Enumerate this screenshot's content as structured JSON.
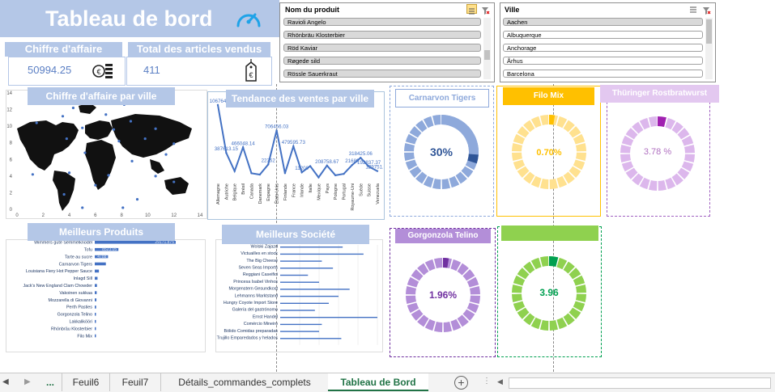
{
  "title": "Tableau de bord",
  "kpi": {
    "revenue_label": "Chiffre d'affaire",
    "revenue_value": "50994.25",
    "items_label": "Total des articles vendus",
    "items_value": "411"
  },
  "slicers": {
    "product": {
      "title": "Nom du produit",
      "items": [
        "Ravioli Angelo",
        "Rhönbräu Klosterbier",
        "Röd Kaviar",
        "Røgede sild",
        "Rössle Sauerkraut"
      ]
    },
    "city": {
      "title": "Ville",
      "items": [
        "Aachen",
        "Albuquerque",
        "Anchorage",
        "Århus",
        "Barcelona"
      ]
    }
  },
  "sections": {
    "map_title": "Chiffre d'affaire par ville",
    "trend_title": "Tendance des ventes par ville",
    "products_title": "Meilleurs Produits",
    "companies_title": "Meilleurs Société"
  },
  "donuts": [
    {
      "title": "Carnarvon Tigers",
      "value_text": "30%",
      "percent": 30,
      "color": "#8ea9db",
      "accent": "#2f5597",
      "title_bg": "#ffffff",
      "title_color": "#8ea9db",
      "text_color": "#2f5597"
    },
    {
      "title": "Filo Mix",
      "value_text": "0.70%",
      "percent": 0.7,
      "color": "#ffe18f",
      "accent": "#ffc000",
      "title_bg": "#ffc000",
      "title_color": "#ffffff",
      "text_color": "#ffc000"
    },
    {
      "title": "Thüringer Rostbratwurst",
      "value_text": "3.78 %",
      "percent": 3.78,
      "color": "#dcb7ec",
      "accent": "#a020b0",
      "title_bg": "#e3c8f0",
      "title_color": "#ffffff",
      "text_color": "#b070c0"
    },
    {
      "title": "Gorgonzola Telino",
      "value_text": "1.96%",
      "percent": 1.96,
      "color": "#b38ed8",
      "accent": "#7030a0",
      "title_bg": "#b38ed8",
      "title_color": "#ffffff",
      "text_color": "#7030a0"
    },
    {
      "title": "",
      "value_text": "3.96",
      "percent": 3.96,
      "color": "#8fd14f",
      "accent": "#00a050",
      "title_bg": "#8fd14f",
      "title_color": "#ffffff",
      "text_color": "#00a050"
    }
  ],
  "chart_data": [
    {
      "type": "scatter",
      "title": "Chiffre d'affaire par ville",
      "xlim": [
        0,
        14
      ],
      "ylim": [
        0,
        14
      ],
      "xticks": [
        "0",
        "2",
        "4",
        "6",
        "8",
        "10",
        "12",
        "14"
      ],
      "yticks": [
        "0",
        "2",
        "4",
        "6",
        "8",
        "10",
        "12",
        "14"
      ],
      "points": [
        [
          1.2,
          13.5
        ],
        [
          4.3,
          12.2
        ],
        [
          6.4,
          12.8
        ],
        [
          8.2,
          12.6
        ],
        [
          9.9,
          12.8
        ],
        [
          11.9,
          12.9
        ],
        [
          3.5,
          11.2
        ],
        [
          6.8,
          11.4
        ],
        [
          8.7,
          10.6
        ],
        [
          1.5,
          10.4
        ],
        [
          5.0,
          9.8
        ],
        [
          7.4,
          9.6
        ],
        [
          10.6,
          9.7
        ],
        [
          3.8,
          8.5
        ],
        [
          7.8,
          8.2
        ],
        [
          9.8,
          8.5
        ],
        [
          12.0,
          7.9
        ],
        [
          5.2,
          6.8
        ],
        [
          11.4,
          6.6
        ],
        [
          8.8,
          5.8
        ],
        [
          1.2,
          4.2
        ],
        [
          4.0,
          4.4
        ],
        [
          7.0,
          4.1
        ],
        [
          10.6,
          4.0
        ],
        [
          12.0,
          3.3
        ],
        [
          6.0,
          2.9
        ],
        [
          3.6,
          1.8
        ],
        [
          9.2,
          1.2
        ],
        [
          5.0,
          0.2
        ],
        [
          8.1,
          0.2
        ]
      ]
    },
    {
      "type": "line",
      "title": "Tendance des ventes par ville",
      "categories": [
        "Allemagne",
        "Autriche",
        "Belgique",
        "Brésil",
        "Canada",
        "Danemark",
        "Espagne",
        "États-Unis",
        "Finlande",
        "France",
        "Irlande",
        "Italie",
        "Mexique",
        "Pays",
        "Pologne",
        "Portugal",
        "Royaume-Uni",
        "Suède",
        "Suisse",
        "Venezuela"
      ],
      "values": [
        1067643,
        387613.15,
        130000,
        466048.14,
        100000,
        80000,
        223521,
        706456.03,
        100000,
        479595.73,
        112000,
        200000,
        40000,
        208758.67,
        70000,
        90000,
        216896,
        318425.06,
        192837.37,
        129751.36
      ],
      "data_labels": [
        "106764",
        "387613.15",
        "",
        "466048.14",
        "",
        "",
        "22352",
        "706456.03",
        "",
        "479595.73",
        "11200",
        "",
        "",
        "208758.67",
        "",
        "",
        "21689",
        "318425.06",
        "192837.37",
        "129751.36"
      ]
    },
    {
      "type": "bar",
      "title": "Meilleurs Produits",
      "categories": [
        "Wimmers gute Semmelknödel",
        "Tofu",
        "Tarte au sucre",
        "Carnarvon Tigers",
        "Louisiana Fiery Hot Pepper Sauce",
        "Inlagd Sill",
        "Jack's New England Clam Chowder",
        "Vakoinen sukkaa",
        "Mozzarella di Giovanni",
        "Perth Pasties",
        "Gorgonzola Telino",
        "Lakkalikööri",
        "Rhönbräu Klosterbier",
        "Filo Mix"
      ],
      "values": [
        29171.875,
        8523,
        4788,
        4000,
        1500,
        1000,
        800,
        700,
        600,
        500,
        400,
        300,
        250,
        200
      ],
      "data_labels": [
        "29171.875",
        "8523.05",
        "4788",
        "",
        "",
        "",
        "",
        "",
        "",
        "",
        "",
        "",
        "",
        ""
      ]
    },
    {
      "type": "bar",
      "title": "Meilleurs Société",
      "categories": [
        "Wolski Zajazd",
        "Victuailles en stock",
        "The Big Cheese",
        "Seven Seas Imports",
        "Reggiani Caseifici",
        "Princesa Isabel Vinhos",
        "Morgenstern Gesundkost",
        "Lehmanns Marktstand",
        "Hungry Coyote Import Store",
        "Galería del gastrónomo",
        "Ernst Handel",
        "Comércio Mineiro",
        "Bólido Comidas preparadas",
        "Ana Trujillo Emparedados y helados"
      ],
      "values": [
        45,
        60,
        30,
        38,
        20,
        28,
        50,
        42,
        35,
        25,
        70,
        30,
        28,
        44
      ]
    }
  ],
  "tabs": {
    "items": [
      "...",
      "Feuil6",
      "Feuil7",
      "Détails_commandes_complets",
      "Tableau de Bord"
    ],
    "active": "Tableau de Bord"
  }
}
